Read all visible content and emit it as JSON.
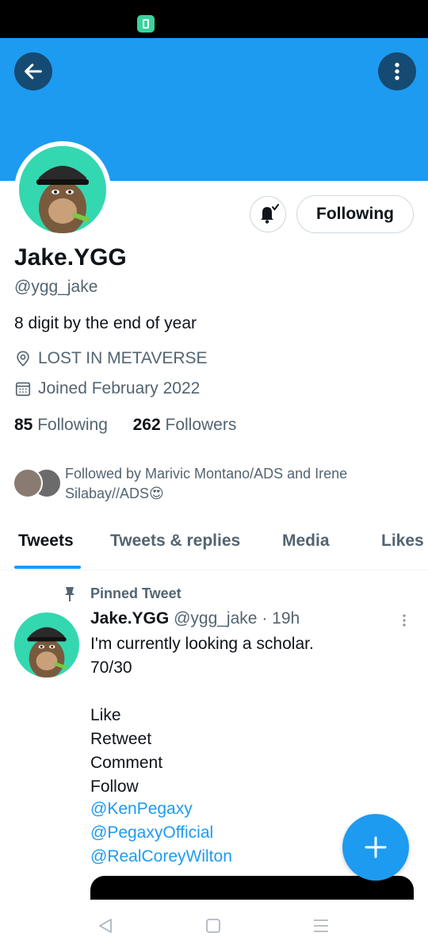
{
  "profile": {
    "name": "Jake.YGG",
    "handle": "@ygg_jake",
    "bio": "8 digit by the end of year",
    "location": "LOST IN METAVERSE",
    "joined": "Joined February 2022",
    "following_count": "85",
    "following_label": "Following",
    "followers_count": "262",
    "followers_label": "Followers",
    "followed_by": "Followed by Marivic Montano/ADS and Irene Silabay//ADS😍",
    "follow_button": "Following"
  },
  "tabs": [
    {
      "label": "Tweets"
    },
    {
      "label": "Tweets & replies"
    },
    {
      "label": "Media"
    },
    {
      "label": "Likes"
    }
  ],
  "pinned_tweet": {
    "pinned_label": "Pinned Tweet",
    "author": "Jake.YGG",
    "handle": "@ygg_jake",
    "time": "· 19h",
    "text": "I'm currently looking a scholar.\n70/30\n\nLike\nRetweet\nComment\nFollow",
    "mentions": [
      "@KenPegaxy",
      "@PegaxyOfficial",
      "@RealCoreyWilton"
    ]
  },
  "colors": {
    "accent": "#1d9bf0",
    "banner": "#1d9bf0",
    "avatar_bg": "#33d8b0"
  },
  "icons": {
    "back": "arrow-left-icon",
    "more": "more-vertical-icon",
    "bell": "bell-check-icon",
    "location": "location-pin-icon",
    "calendar": "calendar-icon",
    "pin": "pin-icon",
    "compose": "plus-icon",
    "nav_back": "triangle-back-icon",
    "nav_home": "square-home-icon",
    "nav_menu": "menu-icon"
  }
}
